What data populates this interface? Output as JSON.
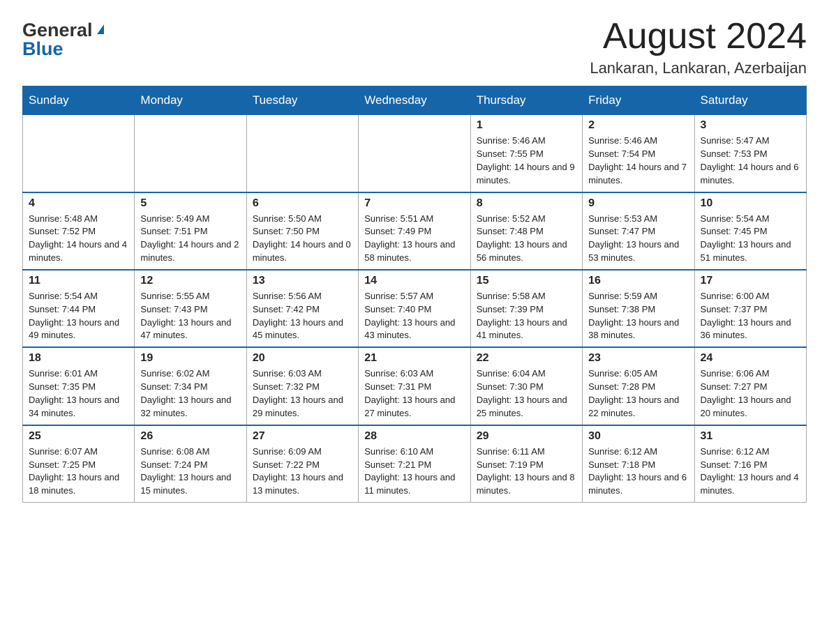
{
  "logo": {
    "text_general": "General",
    "text_blue": "Blue",
    "triangle": "▲"
  },
  "header": {
    "title": "August 2024",
    "subtitle": "Lankaran, Lankaran, Azerbaijan"
  },
  "weekdays": [
    "Sunday",
    "Monday",
    "Tuesday",
    "Wednesday",
    "Thursday",
    "Friday",
    "Saturday"
  ],
  "weeks": [
    [
      {
        "day": "",
        "info": ""
      },
      {
        "day": "",
        "info": ""
      },
      {
        "day": "",
        "info": ""
      },
      {
        "day": "",
        "info": ""
      },
      {
        "day": "1",
        "info": "Sunrise: 5:46 AM\nSunset: 7:55 PM\nDaylight: 14 hours and 9 minutes."
      },
      {
        "day": "2",
        "info": "Sunrise: 5:46 AM\nSunset: 7:54 PM\nDaylight: 14 hours and 7 minutes."
      },
      {
        "day": "3",
        "info": "Sunrise: 5:47 AM\nSunset: 7:53 PM\nDaylight: 14 hours and 6 minutes."
      }
    ],
    [
      {
        "day": "4",
        "info": "Sunrise: 5:48 AM\nSunset: 7:52 PM\nDaylight: 14 hours and 4 minutes."
      },
      {
        "day": "5",
        "info": "Sunrise: 5:49 AM\nSunset: 7:51 PM\nDaylight: 14 hours and 2 minutes."
      },
      {
        "day": "6",
        "info": "Sunrise: 5:50 AM\nSunset: 7:50 PM\nDaylight: 14 hours and 0 minutes."
      },
      {
        "day": "7",
        "info": "Sunrise: 5:51 AM\nSunset: 7:49 PM\nDaylight: 13 hours and 58 minutes."
      },
      {
        "day": "8",
        "info": "Sunrise: 5:52 AM\nSunset: 7:48 PM\nDaylight: 13 hours and 56 minutes."
      },
      {
        "day": "9",
        "info": "Sunrise: 5:53 AM\nSunset: 7:47 PM\nDaylight: 13 hours and 53 minutes."
      },
      {
        "day": "10",
        "info": "Sunrise: 5:54 AM\nSunset: 7:45 PM\nDaylight: 13 hours and 51 minutes."
      }
    ],
    [
      {
        "day": "11",
        "info": "Sunrise: 5:54 AM\nSunset: 7:44 PM\nDaylight: 13 hours and 49 minutes."
      },
      {
        "day": "12",
        "info": "Sunrise: 5:55 AM\nSunset: 7:43 PM\nDaylight: 13 hours and 47 minutes."
      },
      {
        "day": "13",
        "info": "Sunrise: 5:56 AM\nSunset: 7:42 PM\nDaylight: 13 hours and 45 minutes."
      },
      {
        "day": "14",
        "info": "Sunrise: 5:57 AM\nSunset: 7:40 PM\nDaylight: 13 hours and 43 minutes."
      },
      {
        "day": "15",
        "info": "Sunrise: 5:58 AM\nSunset: 7:39 PM\nDaylight: 13 hours and 41 minutes."
      },
      {
        "day": "16",
        "info": "Sunrise: 5:59 AM\nSunset: 7:38 PM\nDaylight: 13 hours and 38 minutes."
      },
      {
        "day": "17",
        "info": "Sunrise: 6:00 AM\nSunset: 7:37 PM\nDaylight: 13 hours and 36 minutes."
      }
    ],
    [
      {
        "day": "18",
        "info": "Sunrise: 6:01 AM\nSunset: 7:35 PM\nDaylight: 13 hours and 34 minutes."
      },
      {
        "day": "19",
        "info": "Sunrise: 6:02 AM\nSunset: 7:34 PM\nDaylight: 13 hours and 32 minutes."
      },
      {
        "day": "20",
        "info": "Sunrise: 6:03 AM\nSunset: 7:32 PM\nDaylight: 13 hours and 29 minutes."
      },
      {
        "day": "21",
        "info": "Sunrise: 6:03 AM\nSunset: 7:31 PM\nDaylight: 13 hours and 27 minutes."
      },
      {
        "day": "22",
        "info": "Sunrise: 6:04 AM\nSunset: 7:30 PM\nDaylight: 13 hours and 25 minutes."
      },
      {
        "day": "23",
        "info": "Sunrise: 6:05 AM\nSunset: 7:28 PM\nDaylight: 13 hours and 22 minutes."
      },
      {
        "day": "24",
        "info": "Sunrise: 6:06 AM\nSunset: 7:27 PM\nDaylight: 13 hours and 20 minutes."
      }
    ],
    [
      {
        "day": "25",
        "info": "Sunrise: 6:07 AM\nSunset: 7:25 PM\nDaylight: 13 hours and 18 minutes."
      },
      {
        "day": "26",
        "info": "Sunrise: 6:08 AM\nSunset: 7:24 PM\nDaylight: 13 hours and 15 minutes."
      },
      {
        "day": "27",
        "info": "Sunrise: 6:09 AM\nSunset: 7:22 PM\nDaylight: 13 hours and 13 minutes."
      },
      {
        "day": "28",
        "info": "Sunrise: 6:10 AM\nSunset: 7:21 PM\nDaylight: 13 hours and 11 minutes."
      },
      {
        "day": "29",
        "info": "Sunrise: 6:11 AM\nSunset: 7:19 PM\nDaylight: 13 hours and 8 minutes."
      },
      {
        "day": "30",
        "info": "Sunrise: 6:12 AM\nSunset: 7:18 PM\nDaylight: 13 hours and 6 minutes."
      },
      {
        "day": "31",
        "info": "Sunrise: 6:12 AM\nSunset: 7:16 PM\nDaylight: 13 hours and 4 minutes."
      }
    ]
  ]
}
